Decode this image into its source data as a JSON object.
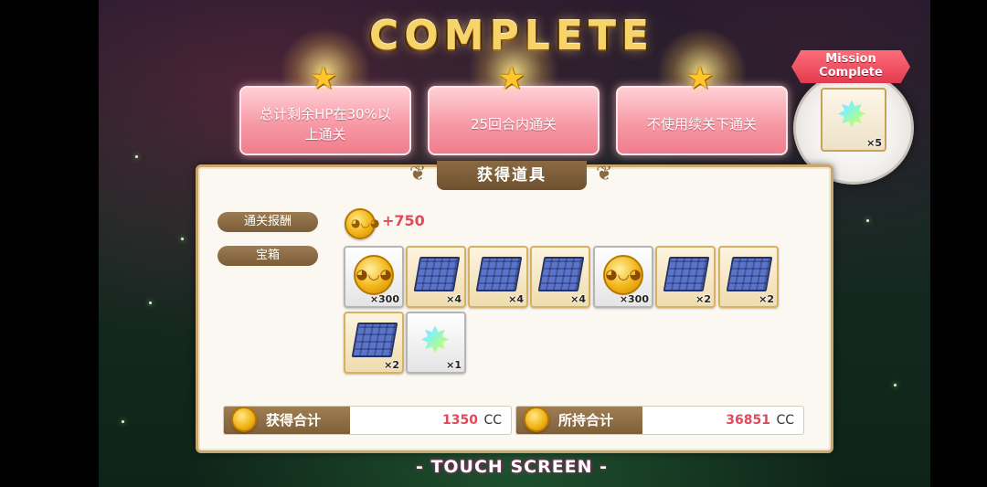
{
  "title": "COMPLETE",
  "missions": [
    {
      "text": "总计剩余HP在30%以上通关"
    },
    {
      "text": "25回合内通关"
    },
    {
      "text": "不使用续关下通关"
    }
  ],
  "badge": {
    "line1": "Mission",
    "line2": "Complete",
    "item_qty": "×5"
  },
  "panel": {
    "header": "获得道具",
    "clear_reward_label": "通关报酬",
    "clear_reward_amount": "+750",
    "chest_label": "宝箱",
    "items": [
      {
        "type": "coin",
        "qty": "×300"
      },
      {
        "type": "book",
        "qty": "×4"
      },
      {
        "type": "book",
        "qty": "×4"
      },
      {
        "type": "book",
        "qty": "×4"
      },
      {
        "type": "coin",
        "qty": "×300"
      },
      {
        "type": "book",
        "qty": "×2"
      },
      {
        "type": "book",
        "qty": "×2"
      },
      {
        "type": "book",
        "qty": "×2"
      },
      {
        "type": "star",
        "qty": "×1"
      }
    ]
  },
  "totals": {
    "earned_label": "获得合计",
    "earned_value": "1350",
    "earned_unit": "CC",
    "held_label": "所持合计",
    "held_value": "36851",
    "held_unit": "CC"
  },
  "footer": "- TOUCH SCREEN -",
  "colors": {
    "accent_red": "#e04a5a",
    "gold": "#f6d46a",
    "pink_card": "#f79aa6",
    "panel_brown": "#8a6a42"
  }
}
